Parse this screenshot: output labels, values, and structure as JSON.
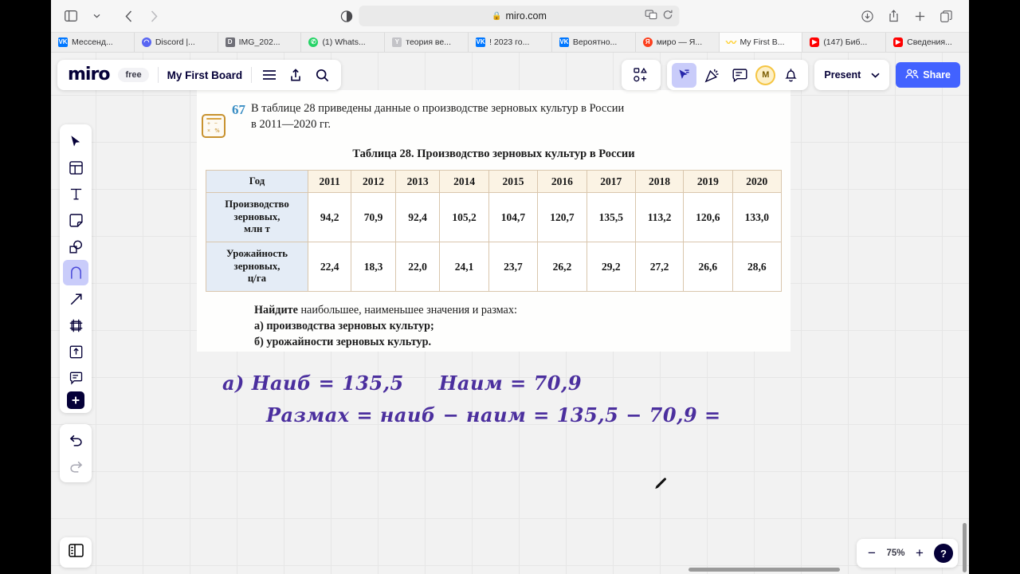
{
  "browser": {
    "address": "miro.com",
    "lock_icon": "lock-icon",
    "nav": {
      "sidebar_icon": "sidebar-toggle-icon",
      "sidebar_chevron_icon": "chevron-down-icon",
      "back_icon": "back-arrow-icon",
      "forward_icon": "forward-arrow-icon",
      "reader_icon": "reader-view-icon",
      "extensions_icon": "extensions-icon",
      "reload_icon": "reload-icon",
      "downloads_icon": "downloads-icon",
      "share_icon": "share-icon",
      "newtab_icon": "new-tab-plus-icon",
      "tabs_overview_icon": "tab-overview-icon"
    },
    "tabs": [
      {
        "label": "Мессенд...",
        "favicon": "vk-icon",
        "fav_text": "VK",
        "active": false
      },
      {
        "label": "Discord |...",
        "favicon": "discord-icon",
        "fav_text": "D",
        "active": false
      },
      {
        "label": "IMG_202...",
        "favicon": "document-icon",
        "fav_text": "D",
        "active": false
      },
      {
        "label": "(1) Whats...",
        "favicon": "whatsapp-icon",
        "fav_text": "W",
        "active": false
      },
      {
        "label": "теория ве...",
        "favicon": "yandex-gray-icon",
        "fav_text": "Y",
        "active": false
      },
      {
        "label": "! 2023 го...",
        "favicon": "vk-icon",
        "fav_text": "VK",
        "active": false
      },
      {
        "label": "Вероятно...",
        "favicon": "vk-icon",
        "fav_text": "VK",
        "active": false
      },
      {
        "label": "миро — Я...",
        "favicon": "yandex-icon",
        "fav_text": "Я",
        "active": false
      },
      {
        "label": "My First B...",
        "favicon": "miro-icon",
        "fav_text": "〰",
        "active": true
      },
      {
        "label": "(147) Биб...",
        "favicon": "youtube-icon",
        "fav_text": "▶",
        "active": false
      },
      {
        "label": "Сведения...",
        "favicon": "youtube-icon",
        "fav_text": "▶",
        "active": false
      }
    ]
  },
  "miro": {
    "logo": "miro",
    "plan_badge": "free",
    "board_name": "My First Board",
    "header_icons": {
      "menu": "hamburger-menu-icon",
      "upload": "upload-icon",
      "search": "search-icon",
      "templates": "templates-icon",
      "cursor_select": "cursor-select-icon",
      "reactions": "reactions-icon",
      "comments": "comments-icon",
      "notifications": "bell-icon"
    },
    "avatar_initial": "M",
    "present_label": "Present",
    "present_chevron": "chevron-down-icon",
    "share_label": "Share",
    "share_icon": "people-icon",
    "share_color": "#4262ff",
    "toolbar": [
      {
        "name": "select-tool",
        "icon": "cursor-arrow-icon",
        "selected": false
      },
      {
        "name": "templates-tool",
        "icon": "template-grid-icon",
        "selected": false
      },
      {
        "name": "text-tool",
        "icon": "text-t-icon",
        "selected": false
      },
      {
        "name": "sticky-note-tool",
        "icon": "sticky-note-icon",
        "selected": false
      },
      {
        "name": "shapes-tool",
        "icon": "shapes-icon",
        "selected": false
      },
      {
        "name": "pen-tool",
        "icon": "pen-draw-icon",
        "selected": true
      },
      {
        "name": "connector-tool",
        "icon": "arrow-connector-icon",
        "selected": false
      },
      {
        "name": "frame-tool",
        "icon": "frame-icon",
        "selected": false
      },
      {
        "name": "upload-tool",
        "icon": "upload-box-icon",
        "selected": false
      },
      {
        "name": "comment-tool",
        "icon": "comment-bubble-icon",
        "selected": false
      },
      {
        "name": "more-apps-tool",
        "icon": "plus-icon",
        "selected": false
      }
    ],
    "undo_icon": "undo-arrow-icon",
    "redo_icon": "redo-arrow-icon",
    "panel_icon": "side-panel-icon",
    "zoom": {
      "minus": "−",
      "level": "75%",
      "plus": "+",
      "help": "?"
    },
    "cursor": "pen-cursor"
  },
  "problem": {
    "number": "67",
    "icon": "calculator-icon",
    "statement_line1": "В таблице 28 приведены данные о производстве зерновых культур в России",
    "statement_line2": "в 2011—2020 гг.",
    "table_title": "Таблица 28. Производство зерновых культур в России",
    "question_intro_bold": "Найдите",
    "question_intro_rest": " наибольшее, наименьшее значения и размах:",
    "question_a": "а) производства зерновых культур;",
    "question_b": "б) урожайности зерновых культур."
  },
  "chart_data": {
    "type": "table",
    "title": "Таблица 28. Производство зерновых культур в России",
    "row_header_label": "Год",
    "categories": [
      "2011",
      "2012",
      "2013",
      "2014",
      "2015",
      "2016",
      "2017",
      "2018",
      "2019",
      "2020"
    ],
    "series": [
      {
        "name": "Производство зерновых, млн т",
        "name_lines": [
          "Производство",
          "зерновых,",
          "млн  т"
        ],
        "values": [
          "94,2",
          "70,9",
          "92,4",
          "105,2",
          "104,7",
          "120,7",
          "135,5",
          "113,2",
          "120,6",
          "133,0"
        ]
      },
      {
        "name": "Урожайность зерновых, ц/га",
        "name_lines": [
          "Урожайность",
          "зерновых,",
          "ц/га"
        ],
        "values": [
          "22,4",
          "18,3",
          "22,0",
          "24,1",
          "23,7",
          "26,2",
          "29,2",
          "27,2",
          "26,6",
          "28,6"
        ]
      }
    ],
    "xlabel": "Год",
    "ylabel": "",
    "grid": true
  },
  "handwriting": {
    "ink_color": "#4b2f9e",
    "line1_part1": "а)  Наиб = 135,5",
    "line1_part2": "Наим = 70,9",
    "line2": "Размах = наиб − наим = 135,5 − 70,9 ="
  }
}
